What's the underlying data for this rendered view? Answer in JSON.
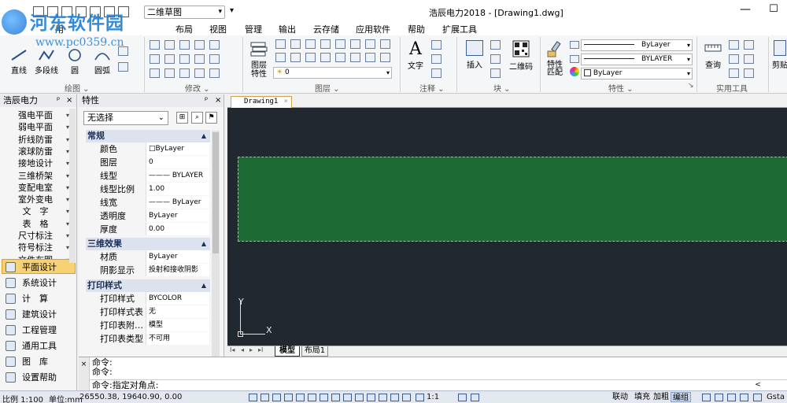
{
  "app": {
    "window_title": "浩辰电力2018 - [Drawing1.dwg]",
    "workspace": "二维草图",
    "min_glyph": "—",
    "max_glyph": "☐"
  },
  "watermark": {
    "text": "河东软件园",
    "url": "www.pc0359.cn"
  },
  "menu": {
    "items": [
      {
        "label": "用"
      },
      {
        "label": "布局"
      },
      {
        "label": "视图"
      },
      {
        "label": "管理"
      },
      {
        "label": "输出"
      },
      {
        "label": "云存储"
      },
      {
        "label": "应用软件"
      },
      {
        "label": "帮助"
      },
      {
        "label": "扩展工具"
      }
    ]
  },
  "ribbon": {
    "draw": {
      "title": "绘图 ⌄",
      "line": "直线",
      "polyline": "多段线",
      "circle": "圆",
      "arc": "圆弧"
    },
    "modify": {
      "title": "修改 ⌄"
    },
    "layer": {
      "title": "图层 ⌄",
      "props_btn": "图层\n特性",
      "layer_combo": "0"
    },
    "annotation": {
      "title": "注释 ⌄",
      "text": "文字"
    },
    "block": {
      "title": "块 ⌄",
      "insert": "插入",
      "qrcode": "二维码"
    },
    "properties": {
      "title": "特性 ⌄",
      "match": "特性\n匹配",
      "color_combo": "ByLayer",
      "linetype_combo": "ByLayer",
      "lineweight_combo": "BYLAYER"
    },
    "utilities": {
      "title": "实用工具",
      "query": "查询"
    },
    "clipboard": {
      "cut": "剪贴"
    }
  },
  "left_panel": {
    "title": "浩辰电力",
    "pin": "ᵖ",
    "close": "×",
    "categories": [
      {
        "label": "强电平面"
      },
      {
        "label": "弱电平面"
      },
      {
        "label": "折线防雷"
      },
      {
        "label": "滚球防雷"
      },
      {
        "label": "接地设计"
      },
      {
        "label": "三维桥架"
      },
      {
        "label": "变配电室"
      },
      {
        "label": "室外变电"
      },
      {
        "label": "文　字"
      },
      {
        "label": "表　格"
      },
      {
        "label": "尺寸标注"
      },
      {
        "label": "符号标注"
      },
      {
        "label": "文件布图"
      }
    ],
    "modules": [
      {
        "label": "平面设计",
        "icon": "plan-design-icon",
        "active": true
      },
      {
        "label": "系统设计",
        "icon": "system-design-icon",
        "active": false
      },
      {
        "label": "计　算",
        "icon": "calculation-icon",
        "active": false
      },
      {
        "label": "建筑设计",
        "icon": "building-design-icon",
        "active": false
      },
      {
        "label": "工程管理",
        "icon": "project-management-icon",
        "active": false
      },
      {
        "label": "通用工具",
        "icon": "general-tools-icon",
        "active": false
      },
      {
        "label": "图　库",
        "icon": "library-icon",
        "active": false
      },
      {
        "label": "设置帮助",
        "icon": "settings-help-icon",
        "active": false
      }
    ]
  },
  "properties_panel": {
    "title": "特性",
    "pin": "ᵖ",
    "close": "×",
    "selection": "无选择",
    "sections": {
      "general": {
        "title": "常规",
        "rows": [
          {
            "key": "颜色",
            "value": "□ByLayer"
          },
          {
            "key": "图层",
            "value": "0"
          },
          {
            "key": "线型",
            "value": "——— BYLAYER"
          },
          {
            "key": "线型比例",
            "value": "1.00"
          },
          {
            "key": "线宽",
            "value": "——— ByLayer"
          },
          {
            "key": "透明度",
            "value": "ByLayer"
          },
          {
            "key": "厚度",
            "value": "0.00"
          }
        ]
      },
      "3d": {
        "title": "三维效果",
        "rows": [
          {
            "key": "材质",
            "value": "ByLayer"
          },
          {
            "key": "阴影显示",
            "value": "投射和接收阴影"
          }
        ]
      },
      "plot": {
        "title": "打印样式",
        "rows": [
          {
            "key": "打印样式",
            "value": "BYCOLOR"
          },
          {
            "key": "打印样式表",
            "value": "无"
          },
          {
            "key": "打印表附…",
            "value": "模型"
          },
          {
            "key": "打印表类型",
            "value": "不可用"
          }
        ]
      }
    }
  },
  "drawing": {
    "doc_tab": "Drawing1",
    "doc_tab_close": "×",
    "ucs_x": "X",
    "ucs_y": "Y",
    "layout_tabs": {
      "model": "模型",
      "layout1": "布局1"
    },
    "nav": [
      "I◂",
      "◂",
      "▸",
      "▸I"
    ]
  },
  "command": {
    "lines": [
      "命令:",
      "命令:"
    ],
    "prompt": "命令:指定对角点:",
    "gutter_close": "×"
  },
  "status": {
    "scale": "比例 1:100",
    "unit": "单位:mm",
    "coords": "26550.38, 19640.90, 0.00",
    "annot_scale": "1:1",
    "toggles": [
      "联动",
      "填充",
      "加粗",
      "编组"
    ],
    "toggle_active": "编组",
    "right_label": "Gsta"
  }
}
